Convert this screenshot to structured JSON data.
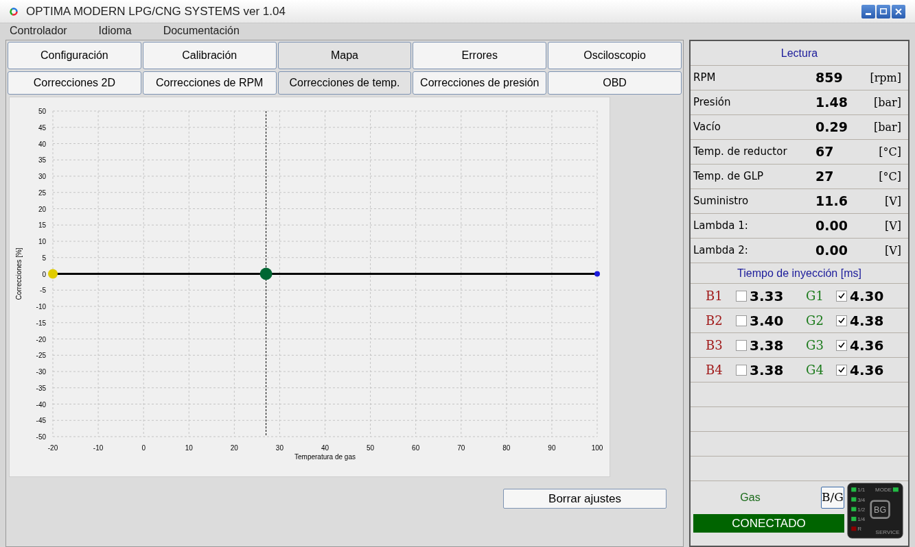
{
  "window": {
    "title": "OPTIMA MODERN LPG/CNG SYSTEMS ver 1.04"
  },
  "menu": [
    "Controlador",
    "Idioma",
    "Documentación"
  ],
  "tabs": [
    {
      "label": "Configuración",
      "selected": false
    },
    {
      "label": "Calibración",
      "selected": false
    },
    {
      "label": "Mapa",
      "selected": true
    },
    {
      "label": "Errores",
      "selected": false
    },
    {
      "label": "Osciloscopio",
      "selected": false
    }
  ],
  "subtabs": [
    {
      "label": "Correcciones 2D",
      "selected": false
    },
    {
      "label": "Correcciones de RPM",
      "selected": false
    },
    {
      "label": "Correcciones de temp.",
      "selected": true
    },
    {
      "label": "Correcciones de presión",
      "selected": false
    },
    {
      "label": "OBD",
      "selected": false
    }
  ],
  "chart": {
    "chart_data": {
      "type": "line",
      "xlabel": "Temperatura de gas",
      "ylabel": "Correcciones [%]",
      "x": [
        -20,
        100
      ],
      "series": [
        {
          "color": "#000000",
          "marker": "circle",
          "values": [
            0,
            0
          ]
        }
      ],
      "grid": true,
      "ref_lines": [
        {
          "axis": "x",
          "value": 27
        }
      ],
      "xlim": [
        -20,
        100
      ],
      "ylim": [
        -50,
        50
      ],
      "xticks": [
        -20,
        -10,
        0,
        10,
        20,
        30,
        40,
        50,
        60,
        70,
        80,
        90,
        100
      ],
      "yticks": [
        -50,
        -45,
        -40,
        -35,
        -30,
        -25,
        -20,
        -15,
        -10,
        -5,
        0,
        5,
        10,
        15,
        20,
        25,
        30,
        35,
        40,
        45,
        50
      ]
    }
  },
  "reset_button": "Borrar ajustes",
  "readings": {
    "title": "Lectura",
    "rows": [
      {
        "name": "RPM",
        "value": "859",
        "unit": "[rpm]"
      },
      {
        "name": "Presión",
        "value": "1.48",
        "unit": "[bar]"
      },
      {
        "name": "Vacío",
        "value": "0.29",
        "unit": "[bar]"
      },
      {
        "name": "Temp. de reductor",
        "value": "67",
        "unit": "[°C]"
      },
      {
        "name": "Temp. de GLP",
        "value": "27",
        "unit": "[°C]"
      },
      {
        "name": "Suministro",
        "value": "11.6",
        "unit": "[V]"
      },
      {
        "name": "Lambda 1:",
        "value": "0.00",
        "unit": "[V]"
      },
      {
        "name": "Lambda 2:",
        "value": "0.00",
        "unit": "[V]"
      }
    ]
  },
  "injection": {
    "title": "Tiempo de inyección [ms]",
    "rows": [
      {
        "petrol": {
          "label": "B1",
          "checked": false,
          "value": "3.33"
        },
        "gas": {
          "label": "G1",
          "checked": true,
          "value": "4.30"
        }
      },
      {
        "petrol": {
          "label": "B2",
          "checked": false,
          "value": "3.40"
        },
        "gas": {
          "label": "G2",
          "checked": true,
          "value": "4.38"
        }
      },
      {
        "petrol": {
          "label": "B3",
          "checked": false,
          "value": "3.38"
        },
        "gas": {
          "label": "G3",
          "checked": true,
          "value": "4.36"
        }
      },
      {
        "petrol": {
          "label": "B4",
          "checked": false,
          "value": "3.38"
        },
        "gas": {
          "label": "G4",
          "checked": true,
          "value": "4.36"
        }
      }
    ]
  },
  "fuel_mode": "Gas",
  "switch_button": "B/G",
  "status": "CONECTADO",
  "controller": {
    "logo": "BG",
    "mode_label": "MODE",
    "service_label": "SERVICE",
    "leds": [
      {
        "label": "1/1",
        "color": "#22bb44"
      },
      {
        "label": "3/4",
        "color": "#22bb44"
      },
      {
        "label": "1/2",
        "color": "#22bb44"
      },
      {
        "label": "1/4",
        "color": "#22bb44"
      },
      {
        "label": "R",
        "color": "#8b0000"
      }
    ]
  }
}
